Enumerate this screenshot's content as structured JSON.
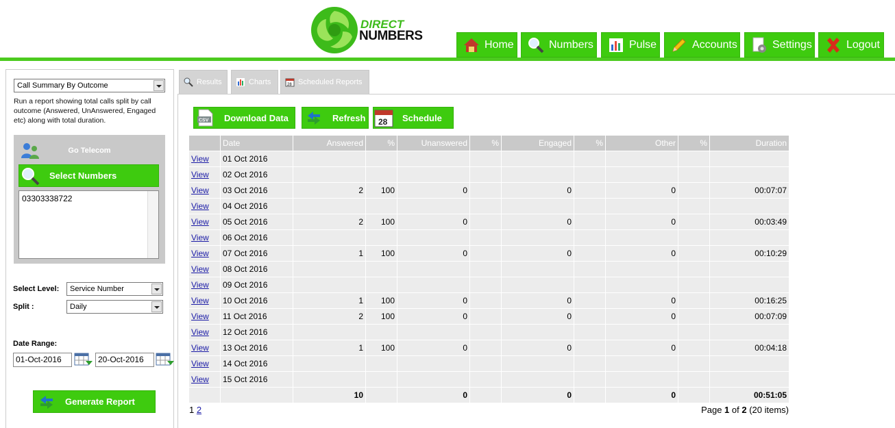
{
  "brand": {
    "line1": "DIRECT",
    "line2": "NUMBERS"
  },
  "nav": [
    {
      "label": "Home",
      "icon": "home-icon"
    },
    {
      "label": "Numbers",
      "icon": "magnifier-icon"
    },
    {
      "label": "Pulse",
      "icon": "bar-chart-icon"
    },
    {
      "label": "Accounts",
      "icon": "pencil-icon"
    },
    {
      "label": "Settings",
      "icon": "settings-icon"
    },
    {
      "label": "Logout",
      "icon": "close-icon"
    }
  ],
  "report": {
    "selected": "Call Summary By Outcome",
    "description": "Run a report showing total calls split by call outcome (Answered, UnAnswered, Engaged etc) along with total duration."
  },
  "numbers": {
    "company": "Go Telecom",
    "select_label": "Select Numbers",
    "list": [
      "03303338722"
    ]
  },
  "filters": {
    "level_label": "Select Level:",
    "level_value": "Service Number",
    "split_label": "Split :",
    "split_value": "Daily",
    "date_range_label": "Date Range:",
    "from": "01-Oct-2016",
    "to": "20-Oct-2016"
  },
  "generate_label": "Generate Report",
  "tabs": [
    "Results",
    "Charts",
    "Scheduled Reports"
  ],
  "actions": {
    "download": "Download Data",
    "refresh": "Refresh",
    "schedule": "Schedule"
  },
  "table": {
    "headers": [
      "",
      "Date",
      "Answered",
      "%",
      "Unanswered",
      "%",
      "Engaged",
      "%",
      "Other",
      "%",
      "Duration"
    ],
    "view_label": "View",
    "rows": [
      [
        "01 Oct 2016",
        "",
        "",
        "",
        "",
        "",
        "",
        "",
        "",
        ""
      ],
      [
        "02 Oct 2016",
        "",
        "",
        "",
        "",
        "",
        "",
        "",
        "",
        ""
      ],
      [
        "03 Oct 2016",
        "2",
        "100",
        "0",
        "",
        "0",
        "",
        "0",
        "",
        "00:07:07"
      ],
      [
        "04 Oct 2016",
        "",
        "",
        "",
        "",
        "",
        "",
        "",
        "",
        ""
      ],
      [
        "05 Oct 2016",
        "2",
        "100",
        "0",
        "",
        "0",
        "",
        "0",
        "",
        "00:03:49"
      ],
      [
        "06 Oct 2016",
        "",
        "",
        "",
        "",
        "",
        "",
        "",
        "",
        ""
      ],
      [
        "07 Oct 2016",
        "1",
        "100",
        "0",
        "",
        "0",
        "",
        "0",
        "",
        "00:10:29"
      ],
      [
        "08 Oct 2016",
        "",
        "",
        "",
        "",
        "",
        "",
        "",
        "",
        ""
      ],
      [
        "09 Oct 2016",
        "",
        "",
        "",
        "",
        "",
        "",
        "",
        "",
        ""
      ],
      [
        "10 Oct 2016",
        "1",
        "100",
        "0",
        "",
        "0",
        "",
        "0",
        "",
        "00:16:25"
      ],
      [
        "11 Oct 2016",
        "2",
        "100",
        "0",
        "",
        "0",
        "",
        "0",
        "",
        "00:07:09"
      ],
      [
        "12 Oct 2016",
        "",
        "",
        "",
        "",
        "",
        "",
        "",
        "",
        ""
      ],
      [
        "13 Oct 2016",
        "1",
        "100",
        "0",
        "",
        "0",
        "",
        "0",
        "",
        "00:04:18"
      ],
      [
        "14 Oct 2016",
        "",
        "",
        "",
        "",
        "",
        "",
        "",
        "",
        ""
      ],
      [
        "15 Oct 2016",
        "",
        "",
        "",
        "",
        "",
        "",
        "",
        "",
        ""
      ]
    ],
    "totals": [
      "",
      "",
      "10",
      "",
      "0",
      "",
      "0",
      "",
      "0",
      "",
      "00:51:05"
    ]
  },
  "pager": {
    "pages": [
      "1",
      "2"
    ],
    "info_prefix": "Page ",
    "current": "1",
    "of": " of ",
    "total_pages": "2",
    "items": " (20 items)"
  }
}
